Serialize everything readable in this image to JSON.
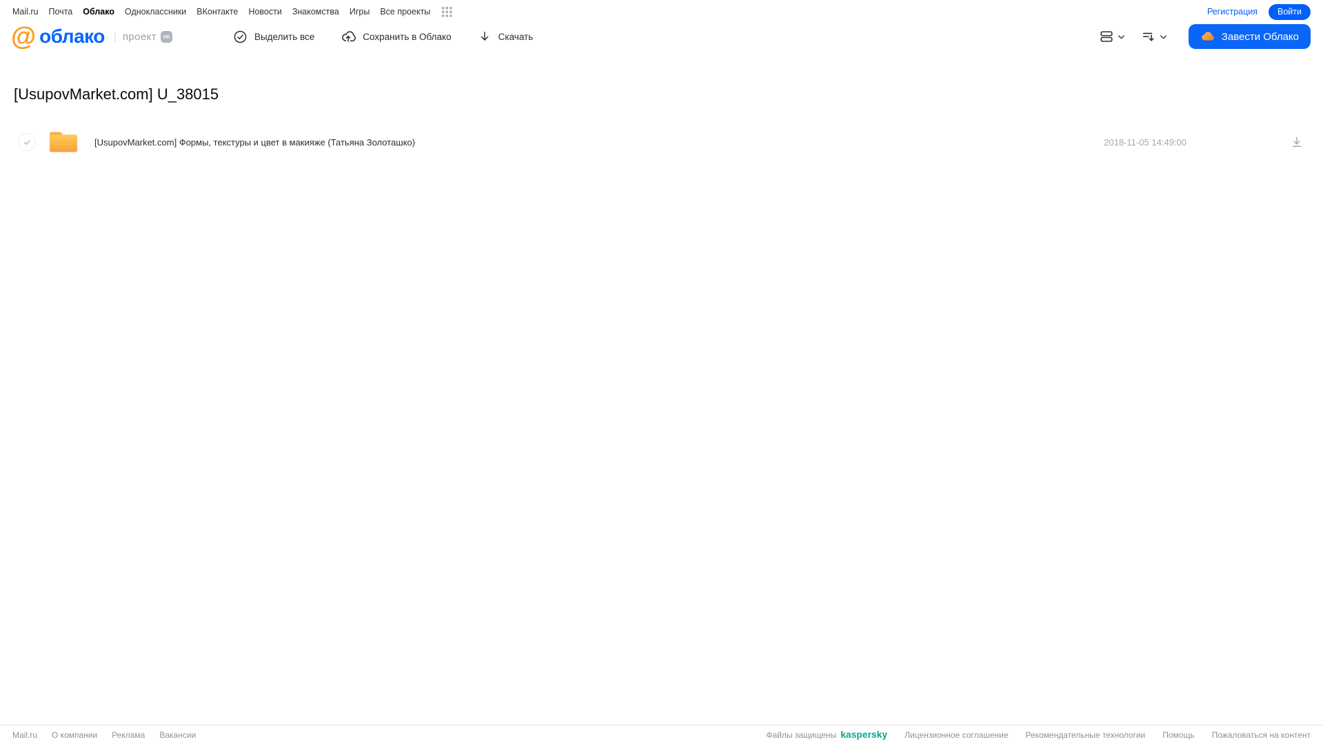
{
  "topbar": {
    "links": [
      "Mail.ru",
      "Почта",
      "Облако",
      "Одноклассники",
      "ВКонтакте",
      "Новости",
      "Знакомства",
      "Игры",
      "Все проекты"
    ],
    "registration_label": "Регистрация",
    "login_label": "Войти"
  },
  "header": {
    "logo_at": "@",
    "logo_text": "облако",
    "divider": "|",
    "project_label": "проект",
    "vk_badge": "VK",
    "select_all_label": "Выделить все",
    "save_to_cloud_label": "Сохранить в Облако",
    "download_label": "Скачать",
    "create_cloud_label": "Завести Облако"
  },
  "content": {
    "title": "[UsupovMarket.com] U_38015",
    "files": [
      {
        "type": "folder",
        "name": "[UsupovMarket.com] Формы, текстуры и цвет в макияже (Татьяна Золоташко)",
        "date": "2018-11-05 14:49:00"
      }
    ]
  },
  "footer": {
    "left_links": [
      "Mail.ru",
      "О компании",
      "Реклама",
      "Вакансии"
    ],
    "protected_label": "Файлы защищены",
    "kaspersky_label": "kaspersky",
    "right_links": [
      "Лицензионное соглашение",
      "Рекомендательные технологии",
      "Помощь",
      "Пожаловаться на контент"
    ]
  },
  "colors": {
    "accent_blue": "#005ff9",
    "button_blue": "#0a66f7",
    "logo_orange": "#fc9b1d",
    "logo_blue": "#0466fe",
    "kaspersky_green": "#00a88e",
    "folder_top": "#ffcb55",
    "folder_bottom": "#f3a43e"
  }
}
